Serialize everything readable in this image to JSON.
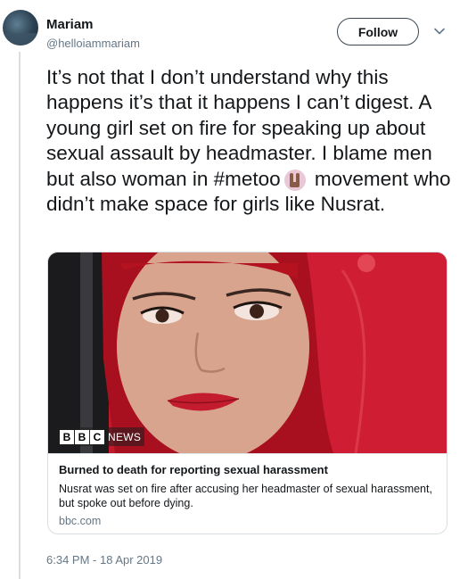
{
  "author": {
    "name": "Mariam",
    "handle": "@helloiammariam"
  },
  "header": {
    "follow_label": "Follow",
    "more_icon": "chevron-down-icon"
  },
  "tweet": {
    "text_part1": "It’s not that I don’t understand why this happens it’s that it happens I can’t digest. A young girl set on fire for speaking up about sexual assault by headmaster. I blame men but also woman in #metoo",
    "emoji": "raised-hand-emoji",
    "text_part2": " movement who didn’t make space for girls like Nusrat.",
    "timestamp": "6:34 PM - 18 Apr 2019"
  },
  "card": {
    "image_alt": "photo of a young woman in a red hijab",
    "badge_letters": [
      "B",
      "B",
      "C"
    ],
    "badge_word": "NEWS",
    "title": "Burned to death for reporting sexual harassment",
    "description": "Nusrat was set on fire after accusing her headmaster of sexual harassment, but spoke out before dying.",
    "domain": "bbc.com"
  },
  "colors": {
    "text": "#14171a",
    "secondary": "#657786",
    "border": "#d9dee3",
    "thread_line": "#d8dde1",
    "hijab_red": "#c4162a"
  }
}
